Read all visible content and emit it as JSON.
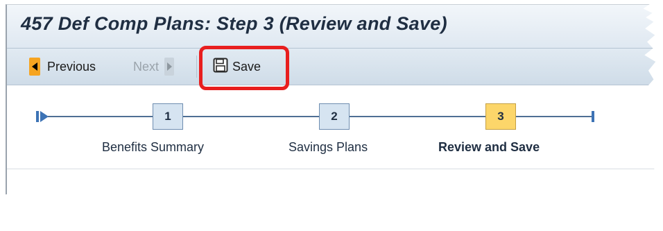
{
  "window": {
    "title": "457 Def Comp Plans: Step 3  (Review and Save)"
  },
  "toolbar": {
    "previous_label": "Previous",
    "next_label": "Next",
    "save_label": "Save"
  },
  "roadmap": {
    "steps": [
      {
        "number": "1",
        "label": "Benefits Summary",
        "active": false
      },
      {
        "number": "2",
        "label": "Savings Plans",
        "active": false
      },
      {
        "number": "3",
        "label": "Review and Save",
        "active": true
      }
    ]
  },
  "colors": {
    "accent_orange": "#f6a421",
    "active_step": "#fcd66a",
    "highlight_red": "#e81e1e",
    "title_text": "#1f2e42"
  },
  "icons": [
    "arrow-left-icon",
    "arrow-right-icon",
    "floppy-disk-icon",
    "roadmap-start-icon",
    "roadmap-end-icon"
  ]
}
